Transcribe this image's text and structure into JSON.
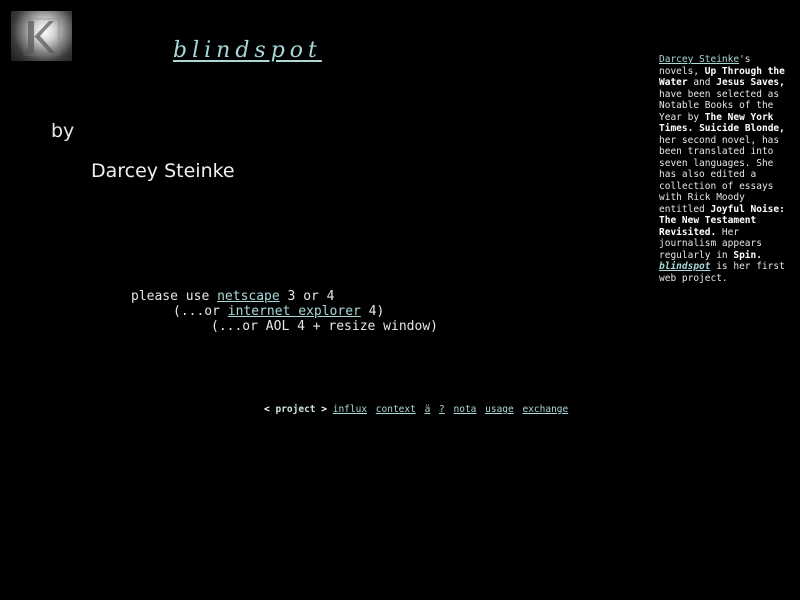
{
  "logo": {
    "icon": "k-logo-icon"
  },
  "title": "blindspot",
  "byline": {
    "by": "by",
    "author": "Darcey Steinke"
  },
  "browser_note": {
    "line1_prefix": "please use ",
    "line1_link": "netscape",
    "line1_suffix": " 3 or 4",
    "line2_prefix": "(...or ",
    "line2_link": "internet explorer",
    "line2_suffix": " 4)",
    "line3": "(...or AOL 4 + resize window)"
  },
  "nav": {
    "open_bracket": "<",
    "current": "project",
    "close_bracket": ">",
    "links": [
      "influx",
      "context",
      "ä",
      "?",
      "nota",
      "usage",
      "exchange"
    ]
  },
  "bio": {
    "author_link": "Darcey Steinke",
    "t1": "'s novels, ",
    "book1": "Up Through the Water",
    "t2": " and ",
    "book2": "Jesus Saves,",
    "t3": " have been selected as Notable Books of the Year by ",
    "paper": "The New York Times.",
    "t4": " ",
    "book3": "Suicide Blonde,",
    "t5": " her second novel, has been translated into seven languages. She has also edited a collection of essays with Rick Moody entitled ",
    "book4": "Joyful Noise: The New Testament Revisited.",
    "t6": " Her journalism appears regularly in ",
    "mag": "Spin.",
    "t7": " ",
    "project_link": "blindspot",
    "t8": " is her first web project."
  }
}
